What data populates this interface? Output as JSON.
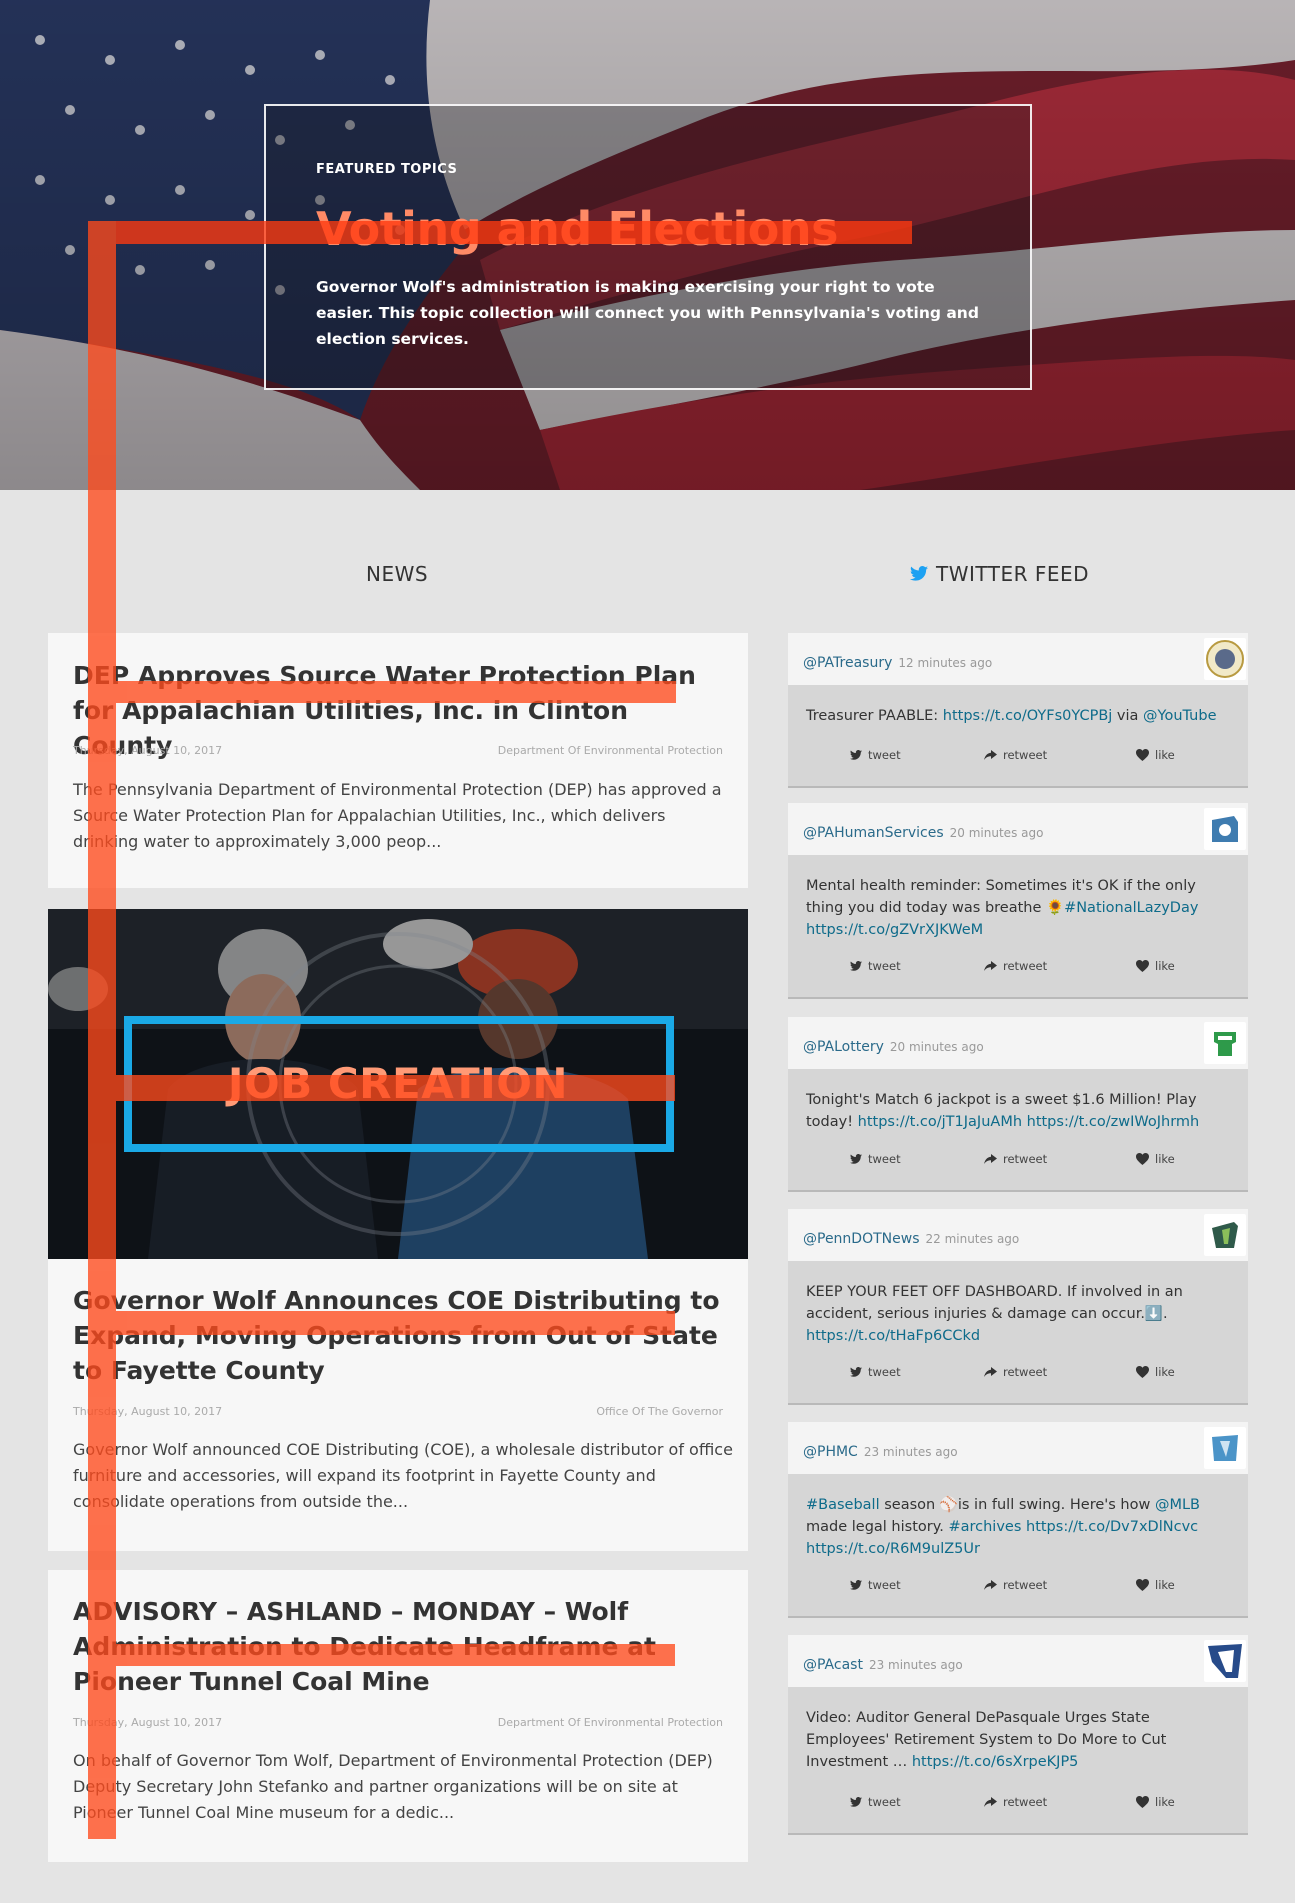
{
  "hero": {
    "eyebrow": "FEATURED TOPICS",
    "title": "Voting and Elections",
    "description": "Governor Wolf's administration is making exercising your right to vote easier. This topic collection will connect you with Pennsylvania's voting and election services."
  },
  "news": {
    "heading": "NEWS",
    "articles": [
      {
        "title": "DEP Approves Source Water Protection Plan for Appalachian Utilities, Inc. in Clinton County",
        "date": "Thursday, August 10, 2017",
        "source": "Department Of Environmental Protection",
        "excerpt": "The Pennsylvania Department of Environmental Protection (DEP) has approved a Source Water Protection Plan for Appalachian Utilities, Inc., which delivers drinking water to approximately 3,000 peop..."
      },
      {
        "title": "Governor Wolf Announces COE Distributing to Expand, Moving Operations from Out of State to Fayette County",
        "date": "Thursday, August 10, 2017",
        "source": "Office Of The Governor",
        "excerpt": "Governor Wolf announced COE Distributing (COE), a wholesale distributor of office furniture and accessories, will expand its footprint in Fayette County and consolidate operations from outside the..."
      },
      {
        "title": "ADVISORY – ASHLAND – MONDAY – Wolf Administration to Dedicate Headframe at Pioneer Tunnel Coal Mine",
        "date": "Thursday, August 10, 2017",
        "source": "Department Of Environmental Protection",
        "excerpt": "On behalf of Governor Tom Wolf, Department of Environmental Protection (DEP) Deputy Secretary John Stefanko and partner organizations will be on site at Pioneer Tunnel Coal Mine museum for a dedic..."
      }
    ],
    "banner": {
      "label": "JOB CREATION"
    }
  },
  "twitter": {
    "heading": "TWITTER FEED",
    "actions": {
      "tweet": "tweet",
      "retweet": "retweet",
      "like": "like"
    },
    "tweets": [
      {
        "user": "@PATreasury",
        "time": "12 minutes ago",
        "text_parts": [
          "Treasurer PAABLE: ",
          "https://t.co/OYFs0YCPBj",
          " via ",
          "@YouTube"
        ]
      },
      {
        "user": "@PAHumanServices",
        "time": "20 minutes ago",
        "text_parts": [
          "Mental health reminder: Sometimes it's OK if the only thing you did today was breathe 🌻",
          "#NationalLazyDay",
          " ",
          "https://t.co/gZVrXJKWeM"
        ]
      },
      {
        "user": "@PALottery",
        "time": "20 minutes ago",
        "text_parts": [
          "Tonight's Match 6 jackpot is a sweet $1.6 Million! Play today! ",
          "https://t.co/jT1JaJuAMh",
          " ",
          "https://t.co/zwIWoJhrmh"
        ]
      },
      {
        "user": "@PennDOTNews",
        "time": "22 minutes ago",
        "text_parts": [
          "KEEP YOUR FEET OFF DASHBOARD. If involved in an accident, serious injuries & damage can occur.⬇️.",
          "",
          " ",
          "https://t.co/tHaFp6CCkd"
        ]
      },
      {
        "user": "@PHMC",
        "time": "23 minutes ago",
        "text_parts": [
          "",
          "#Baseball",
          " season ⚾is in full swing. Here's how ",
          "@MLB",
          " made legal history. ",
          "#archives",
          " ",
          "https://t.co/Dv7xDlNcvc",
          " ",
          "https://t.co/R6M9ulZ5Ur"
        ]
      },
      {
        "user": "@PAcast",
        "time": "23 minutes ago",
        "text_parts": [
          "Video: Auditor General DePasquale Urges State Employees' Retirement System to Do More to Cut Investment … ",
          "https://t.co/6sXrpeKJP5"
        ]
      }
    ]
  },
  "colors": {
    "accent": "#ff8a66",
    "twitter_blue": "#1da1f2",
    "frame_blue": "#1aa9e6",
    "link": "#0e6b8a",
    "overlay": "#ff4a1c"
  }
}
